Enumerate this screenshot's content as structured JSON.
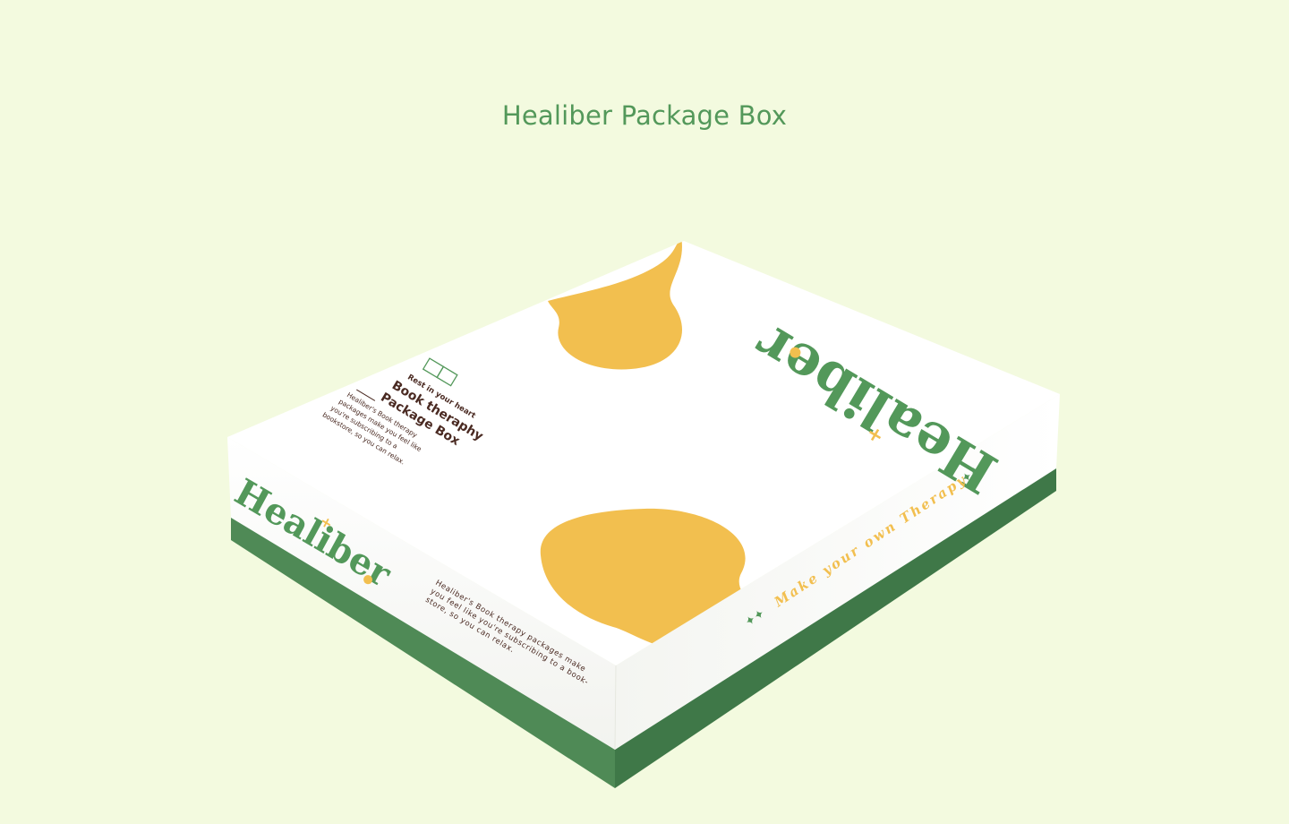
{
  "page": {
    "title": "Healiber Package Box"
  },
  "box": {
    "brand": "Healiber",
    "lid_label": {
      "kicker": "Rest in your heart",
      "heading_line1": "Book theraphy",
      "heading_line2": "Package Box",
      "body_line1": "Healiber's Book therapy",
      "body_line2": "packages make you feel like",
      "body_line3": "you're subscribing to a",
      "body_line4": "bookstore, so you can relax."
    },
    "front_side": {
      "line1": "Healiber's Book therapy packages make",
      "line2": "you feel like you're subscribing to a book-",
      "line3": "store, so you can relax."
    },
    "right_side_slogan": "Make your own Therapy",
    "colors": {
      "background": "#f3fadf",
      "brand_green": "#53985a",
      "base_green": "#4f8a56",
      "blob_yellow": "#f2bf4f",
      "text_brown": "#4a2a22",
      "box_white": "#ffffff"
    }
  }
}
